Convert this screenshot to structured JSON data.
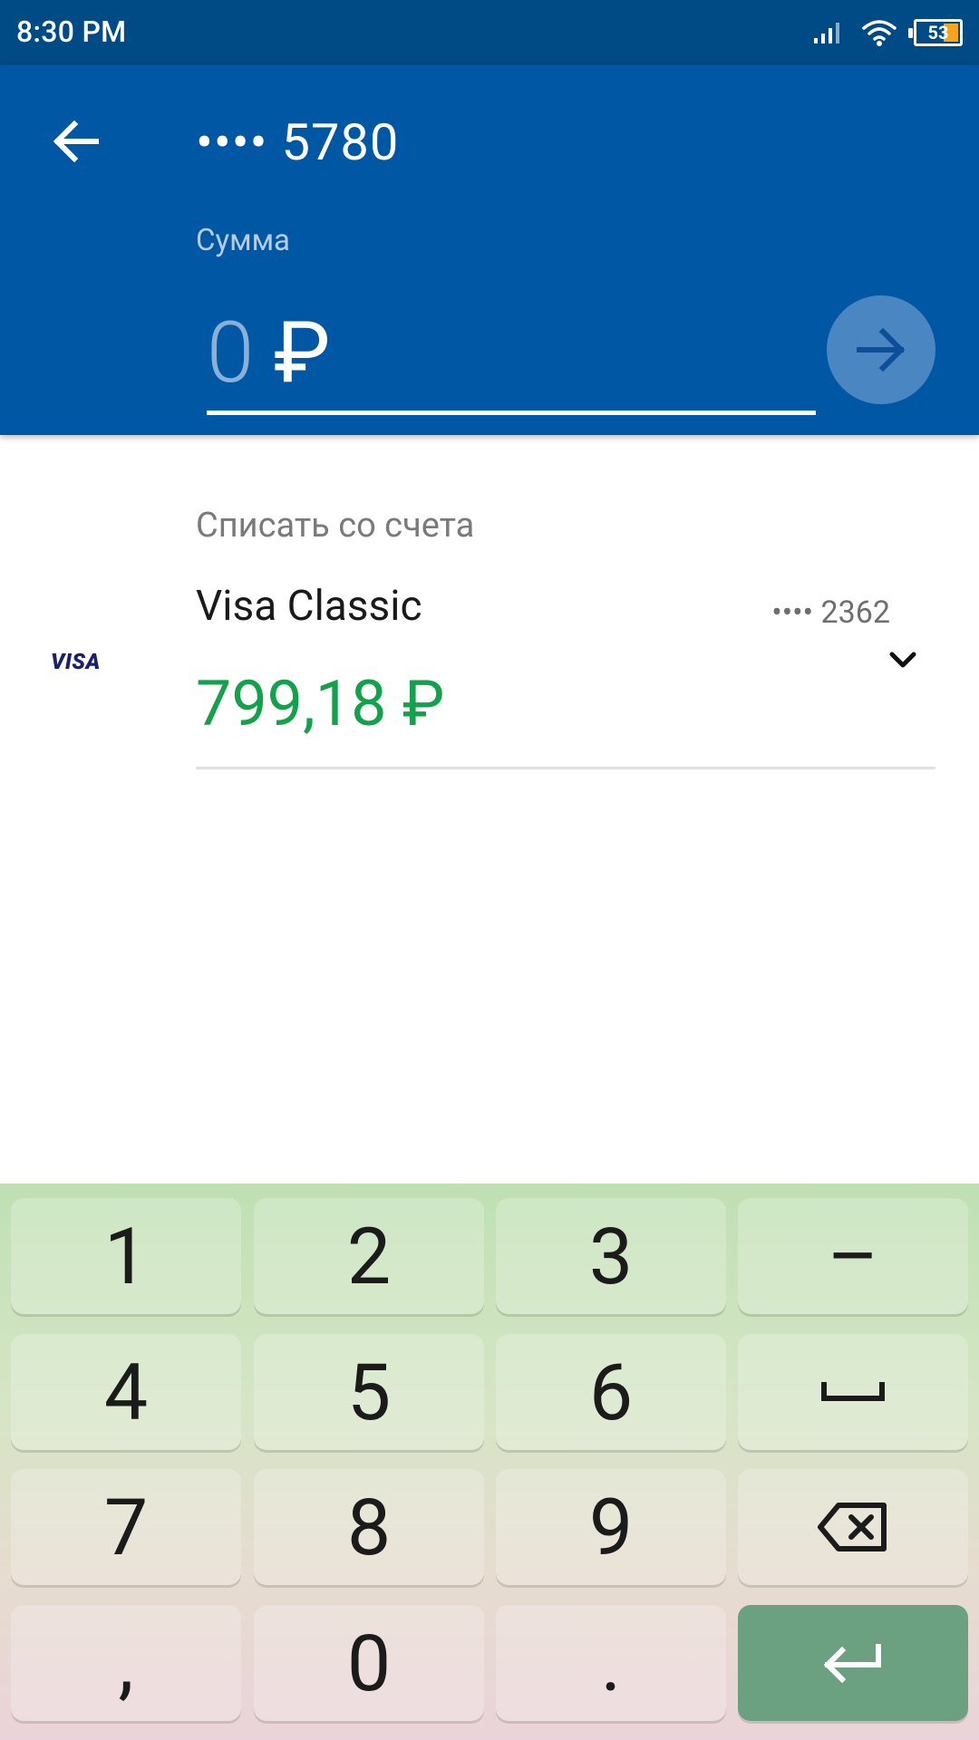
{
  "status": {
    "time": "8:30 PM",
    "battery": "53"
  },
  "header": {
    "card_number": "•••• 5780",
    "amount_label": "Сумма",
    "amount_value": "0",
    "currency": "₽"
  },
  "account": {
    "section_label": "Списать со счета",
    "logo_text": "VISA",
    "name": "Visa Classic",
    "masked_number": "•••• 2362",
    "balance": "799,18 ₽"
  },
  "keyboard": {
    "rows": [
      [
        "1",
        "2",
        "3",
        "–"
      ],
      [
        "4",
        "5",
        "6",
        "space-icon"
      ],
      [
        "7",
        "8",
        "9",
        "backspace-icon"
      ],
      [
        ",",
        "0",
        ".",
        "enter-icon"
      ]
    ]
  },
  "colors": {
    "status_bar": "#004a85",
    "header": "#0057a3",
    "balance": "#13a24b",
    "enter_key": "#6ba081"
  }
}
